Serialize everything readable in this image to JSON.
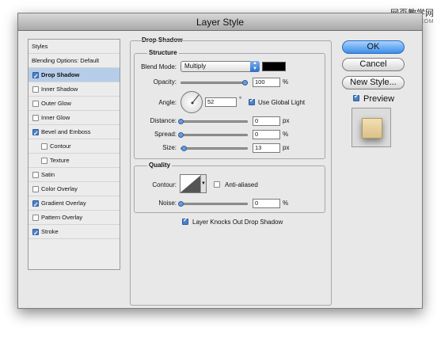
{
  "watermark": {
    "line1": "网页教学网",
    "line2": "WWW.WEB3X.COM"
  },
  "window": {
    "title": "Layer Style"
  },
  "styles_list": {
    "header": "Styles",
    "blending": "Blending Options: Default",
    "items": [
      {
        "label": "Drop Shadow",
        "checked": true,
        "selected": true,
        "indent": false
      },
      {
        "label": "Inner Shadow",
        "checked": false,
        "indent": false
      },
      {
        "label": "Outer Glow",
        "checked": false,
        "indent": false
      },
      {
        "label": "Inner Glow",
        "checked": false,
        "indent": false
      },
      {
        "label": "Bevel and Emboss",
        "checked": true,
        "indent": false
      },
      {
        "label": "Contour",
        "checked": false,
        "indent": true
      },
      {
        "label": "Texture",
        "checked": false,
        "indent": true
      },
      {
        "label": "Satin",
        "checked": false,
        "indent": false
      },
      {
        "label": "Color Overlay",
        "checked": false,
        "indent": false
      },
      {
        "label": "Gradient Overlay",
        "checked": true,
        "indent": false
      },
      {
        "label": "Pattern Overlay",
        "checked": false,
        "indent": false
      },
      {
        "label": "Stroke",
        "checked": true,
        "indent": false
      }
    ]
  },
  "drop_shadow": {
    "title": "Drop Shadow",
    "structure": {
      "title": "Structure",
      "blend_mode_label": "Blend Mode:",
      "blend_mode_value": "Multiply",
      "shadow_color": "#000000",
      "opacity_label": "Opacity:",
      "opacity_value": "100",
      "opacity_level": 1.0,
      "pct": "%",
      "angle_label": "Angle:",
      "angle_value": "52",
      "degree": "°",
      "use_global_light": "Use Global Light",
      "use_global_light_checked": true,
      "distance_label": "Distance:",
      "distance_value": "0",
      "distance_level": 0,
      "spread_label": "Spread:",
      "spread_value": "0",
      "spread_level": 0,
      "size_label": "Size:",
      "size_value": "13",
      "size_level": 0.05,
      "px": "px"
    },
    "quality": {
      "title": "Quality",
      "contour_label": "Contour:",
      "anti_aliased": "Anti-aliased",
      "anti_aliased_checked": false,
      "noise_label": "Noise:",
      "noise_value": "0",
      "noise_level": 0,
      "pct": "%"
    },
    "knockout": "Layer Knocks Out Drop Shadow",
    "knockout_checked": true
  },
  "buttons": {
    "ok": "OK",
    "cancel": "Cancel",
    "new_style": "New Style..."
  },
  "preview": {
    "label": "Preview",
    "checked": true,
    "swatch_color": "#dcc189"
  }
}
